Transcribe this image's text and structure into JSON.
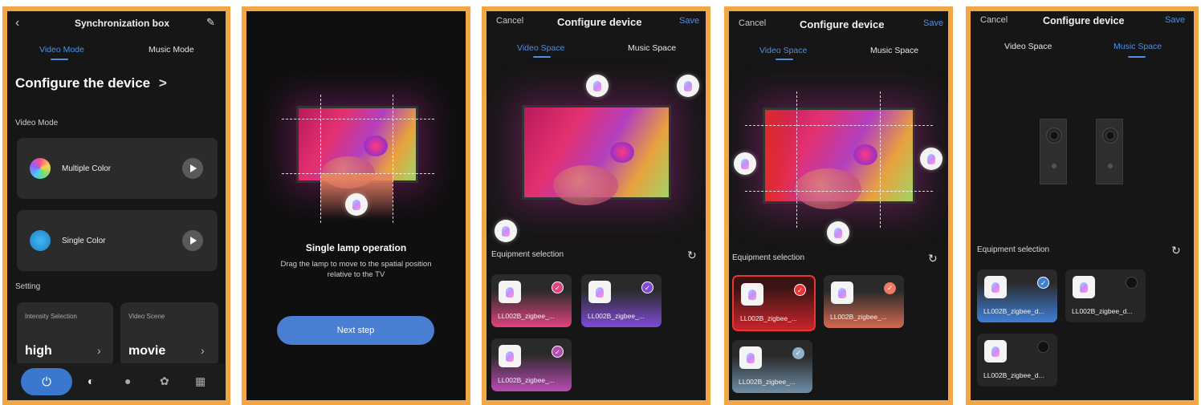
{
  "panel1": {
    "nav_title": "Synchronization box",
    "back_icon": "chevron-left-icon",
    "edit_icon": "edit-icon",
    "tabs": [
      "Video Mode",
      "Music Mode"
    ],
    "heading": "Configure the device",
    "heading_chevron": ">",
    "section_video": "Video Mode",
    "modes": [
      {
        "label": "Multiple Color"
      },
      {
        "label": "Single Color"
      }
    ],
    "section_setting": "Setting",
    "settings": [
      {
        "caption": "Intensity Selection",
        "value": "high"
      },
      {
        "caption": "Video Scene",
        "value": "movie"
      }
    ],
    "bottom_icons": [
      "power-icon",
      "sync-icon",
      "bulb-icon",
      "palette-icon",
      "grid-icon"
    ]
  },
  "panel2": {
    "title": "Single lamp operation",
    "description": "Drag the lamp to move to the spatial position relative to the TV",
    "button": "Next step"
  },
  "panel3": {
    "cancel": "Cancel",
    "title": "Configure device",
    "save": "Save",
    "tabs": [
      "Video Space",
      "Music Space"
    ],
    "equipment_title": "Equipment selection",
    "devices": [
      {
        "name": "LL002B_zigbee_...",
        "color": "#e0437f",
        "checked": true
      },
      {
        "name": "LL002B_zigbee_...",
        "color": "#7e4ad6",
        "checked": true
      },
      {
        "name": "LL002B_zigbee_...",
        "color": "#b94bb5",
        "checked": true
      }
    ]
  },
  "panel4": {
    "cancel": "Cancel",
    "title": "Configure device",
    "save": "Save",
    "tabs": [
      "Video Space",
      "Music Space"
    ],
    "equipment_title": "Equipment selection",
    "devices": [
      {
        "name": "LL002B_zigbee_...",
        "color": "#c8242b",
        "checked": true
      },
      {
        "name": "LL002B_zigbee_...",
        "color": "#d36a52",
        "checked": true
      },
      {
        "name": "LL002B_zigbee_...",
        "color": "#6f8fa8",
        "checked": true
      }
    ]
  },
  "panel5": {
    "cancel": "Cancel",
    "title": "Configure device",
    "save": "Save",
    "tabs": [
      "Video Space",
      "Music Space"
    ],
    "equipment_title": "Equipment selection",
    "devices": [
      {
        "name": "LL002B_zigbee_d...",
        "color": "#3f7fd8",
        "checked": true
      },
      {
        "name": "LL002B_zigbee_d...",
        "color": "#2a2a2a",
        "checked": false
      },
      {
        "name": "LL002B_zigbee_d...",
        "color": "#2a2a2a",
        "checked": false
      }
    ]
  },
  "colors": {
    "frame": "#f2a646",
    "accent": "#4f8fe6",
    "screen_bg": "#161616"
  }
}
